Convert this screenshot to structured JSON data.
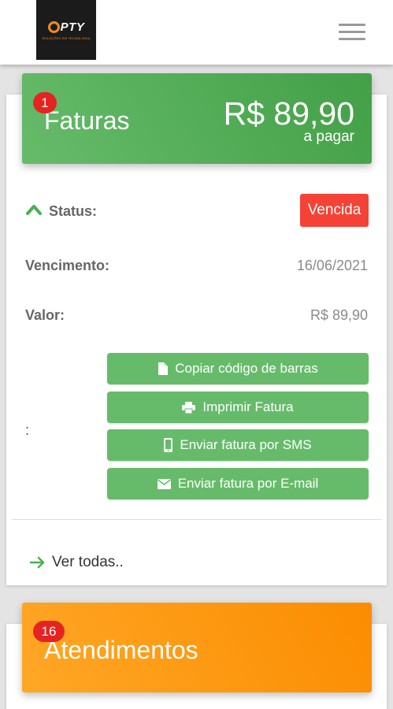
{
  "brand": {
    "logo_text": "PTY",
    "logo_tagline": "SOLUÇÕES EM TECNOLOGIA"
  },
  "faturas": {
    "badge_count": "1",
    "title": "Faturas",
    "amount": "R$ 89,90",
    "amount_caption": "a pagar",
    "status_label": "Status:",
    "status_value": "Vencida",
    "vencimento_label": "Vencimento:",
    "vencimento_value": "16/06/2021",
    "valor_label": "Valor:",
    "valor_value": "R$ 89,90",
    "actions_label": ":",
    "buttons": [
      {
        "label": "Copiar código de barras",
        "icon": "document-icon"
      },
      {
        "label": "Imprimir Fatura",
        "icon": "printer-icon"
      },
      {
        "label": "Enviar fatura por SMS",
        "icon": "phone-icon"
      },
      {
        "label": "Enviar fatura por E-mail",
        "icon": "envelope-icon"
      }
    ],
    "see_all": "Ver todas.."
  },
  "atendimentos": {
    "badge_count": "16",
    "title": "Atendimentos"
  },
  "colors": {
    "green": "#66bb6a",
    "orange": "#fb8c00",
    "danger": "#f44336",
    "badge": "#e52421"
  }
}
